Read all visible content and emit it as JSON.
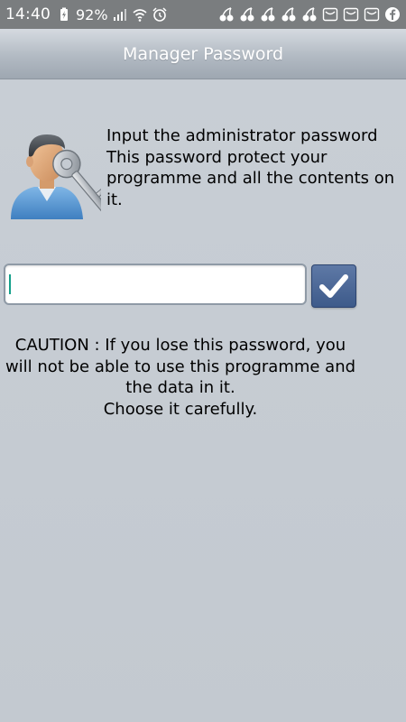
{
  "status_bar": {
    "time": "14:40",
    "battery_percent": "92%",
    "left_icons": [
      "battery-charging-icon",
      "signal-icon",
      "wifi-icon",
      "alarm-icon"
    ],
    "right_icons": [
      "cherry-icon",
      "cherry-icon",
      "cherry-icon",
      "cherry-icon",
      "cherry-icon",
      "mail-icon",
      "mail-icon",
      "mail-icon",
      "facebook-icon"
    ]
  },
  "header": {
    "title": "Manager Password"
  },
  "intro": {
    "line1": "Input the administrator password",
    "line2": "This password protect your programme and all the contents on it."
  },
  "password": {
    "value": "",
    "placeholder": ""
  },
  "confirm": {
    "icon": "checkmark-icon",
    "color": "#4a6796"
  },
  "caution": {
    "line1": "CAUTION : If you lose this password, you will not be able to use this programme and the data in it.",
    "line2": "Choose it carefully."
  }
}
